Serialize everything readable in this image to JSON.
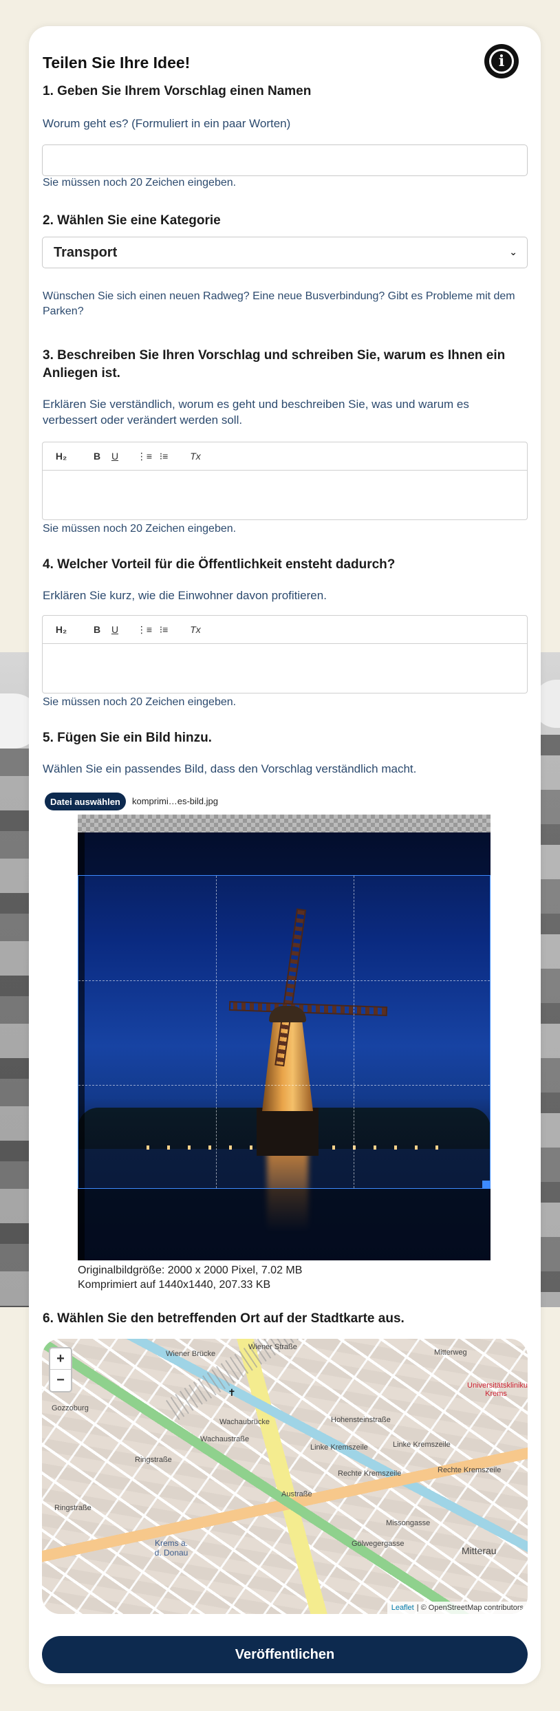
{
  "form": {
    "title": "Teilen Sie Ihre Idee!",
    "section1": {
      "heading": "1. Geben Sie Ihrem Vorschlag einen Namen",
      "hint": "Worum geht es? (Formuliert in ein paar Worten)",
      "input_value": "",
      "counter": "Sie müssen noch 20 Zeichen eingeben."
    },
    "section2": {
      "heading": "2. Wählen Sie eine Kategorie",
      "selected": "Transport",
      "hint": "Wünschen Sie sich einen neuen Radweg? Eine neue Busverbindung? Gibt es Probleme mit dem Parken?"
    },
    "section3": {
      "heading": "3. Beschreiben Sie Ihren Vorschlag und schreiben Sie, warum es Ihnen ein Anliegen ist.",
      "hint": "Erklären Sie verständlich, worum es geht und beschreiben Sie, was und warum es verbessert oder verändert werden soll.",
      "counter": "Sie müssen noch 20 Zeichen eingeben."
    },
    "section4": {
      "heading": "4. Welcher Vorteil für die Öffentlichkeit ensteht dadurch?",
      "hint": "Erklären Sie kurz, wie die Einwohner davon profitieren.",
      "counter": "Sie müssen noch 20 Zeichen eingeben."
    },
    "section5": {
      "heading": "5. Fügen Sie ein Bild hinzu.",
      "hint": "Wählen Sie ein passendes Bild, dass den Vorschlag verständlich macht.",
      "file_button": "Datei auswählen",
      "file_name": "komprimi…es-bild.jpg",
      "original_size": "Originalbildgröße: 2000 x 2000 Pixel, 7.02 MB",
      "compressed": "Komprimiert auf 1440x1440, 207.33 KB"
    },
    "section6": {
      "heading": "6. Wählen Sie den betreffenden Ort auf der Stadtkarte aus."
    },
    "publish_label": "Veröffentlichen"
  },
  "toolbar": {
    "h2": "H₂",
    "bold": "B",
    "underline": "U",
    "ordered_list": "⋮≡",
    "bullet_list": "⁝≡",
    "clear": "Tx"
  },
  "map": {
    "zoom_in": "+",
    "zoom_out": "−",
    "labels": {
      "wiener_bruecke": "Wiener Brücke",
      "wiener_strasse": "Wiener Straße",
      "mitterweg": "Mitterweg",
      "gozzoburg": "Gozzoburg",
      "wachaubruecke": "Wachaubrücke",
      "hohensteinstrasse": "Hohensteinstraße",
      "linke_kremszeile": "Linke Kremszeile",
      "rechte_kremszeile": "Rechte Kremszeile",
      "ringstrasse": "Ringstraße",
      "wachaustrasse": "Wachaustraße",
      "krems": "Krems a. d. Donau",
      "missongasse": "Missongasse",
      "goelwegergasse": "Gölwegergasse",
      "mitterau": "Mitterau",
      "uniklinik": "Universitätsklinikum Krems",
      "austrasse": "Austraße"
    },
    "attribution_leaflet": "Leaflet",
    "attribution_osm": "| © OpenStreetMap contributors"
  },
  "icons": {
    "info": "info-icon",
    "select_chevron": "chevron-down-icon"
  },
  "colors": {
    "accent": "#0d2a4f",
    "hint_text": "#2c4a6e",
    "background": "#f3efe3"
  }
}
